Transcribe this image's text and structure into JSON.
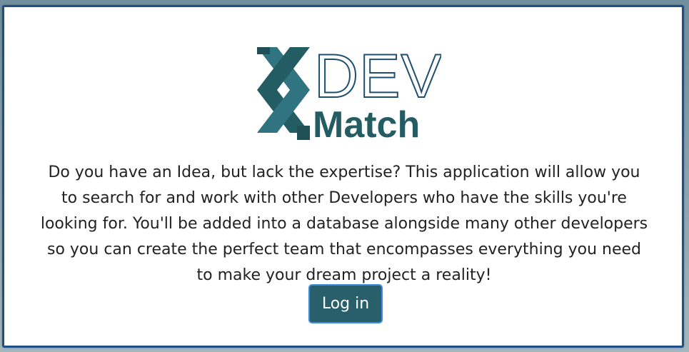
{
  "logo": {
    "line1": "DEV",
    "line2": "Match",
    "icon": "dna-x-icon",
    "colors": {
      "dark_teal": "#245c64",
      "mid_teal": "#2f7480",
      "outline": "#1e4f6e"
    }
  },
  "content": {
    "description": "Do you have an Idea, but lack the expertise? This application will allow you to search for and work with other Developers who have the skills you're looking for. You'll be added into a database alongside many other developers so you can create the perfect team that encompasses everything you need to make your dream project a reality!"
  },
  "actions": {
    "login_label": "Log in"
  },
  "theme": {
    "card_border": "#1f4f8a",
    "button_bg": "#285f6b",
    "button_border": "#3b8ce0"
  }
}
